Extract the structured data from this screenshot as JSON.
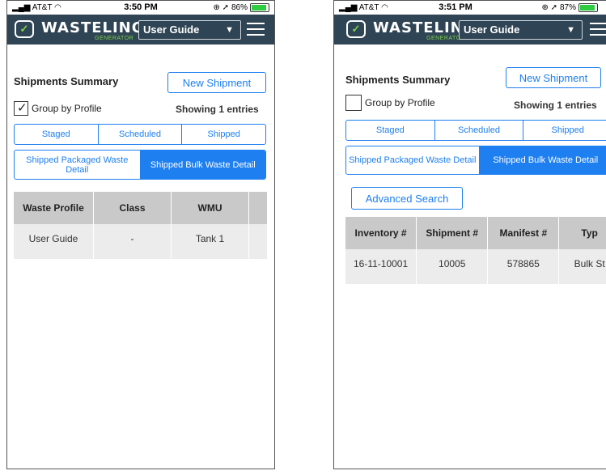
{
  "left": {
    "status": {
      "carrier": "AT&T",
      "time": "3:50 PM",
      "battery": "86%"
    },
    "app": {
      "brand": "WASTELINQ",
      "brand_sub": "GENERATOR",
      "select": "User Guide"
    },
    "title": "Shipments Summary",
    "new_button": "New Shipment",
    "group_label": "Group by Profile",
    "group_checked": true,
    "showing": "Showing 1 entries",
    "tabs": [
      "Staged",
      "Scheduled",
      "Shipped"
    ],
    "subtabs": [
      "Shipped Packaged Waste Detail",
      "Shipped Bulk Waste Detail"
    ],
    "table": {
      "headers": [
        "Waste Profile",
        "Class",
        "WMU"
      ],
      "rows": [
        [
          "User Guide",
          "-",
          "Tank 1"
        ]
      ]
    }
  },
  "right": {
    "status": {
      "carrier": "AT&T",
      "time": "3:51 PM",
      "battery": "87%"
    },
    "app": {
      "brand": "WASTELINQ",
      "brand_sub": "GENERATOR",
      "select": "User Guide"
    },
    "title": "Shipments Summary",
    "new_button": "New Shipment",
    "group_label": "Group by Profile",
    "group_checked": false,
    "showing": "Showing 1 entries",
    "tabs": [
      "Staged",
      "Scheduled",
      "Shipped"
    ],
    "subtabs": [
      "Shipped Packaged Waste Detail",
      "Shipped Bulk Waste Detail"
    ],
    "advanced_search": "Advanced Search",
    "table": {
      "headers": [
        "Inventory #",
        "Shipment #",
        "Manifest #",
        "Typ"
      ],
      "rows": [
        [
          "16-11-10001",
          "10005",
          "578865",
          "Bulk St"
        ]
      ]
    }
  },
  "colors": {
    "appbar": "#2f4454",
    "accent": "#1e7ff0",
    "brand_green": "#7cd24c"
  }
}
